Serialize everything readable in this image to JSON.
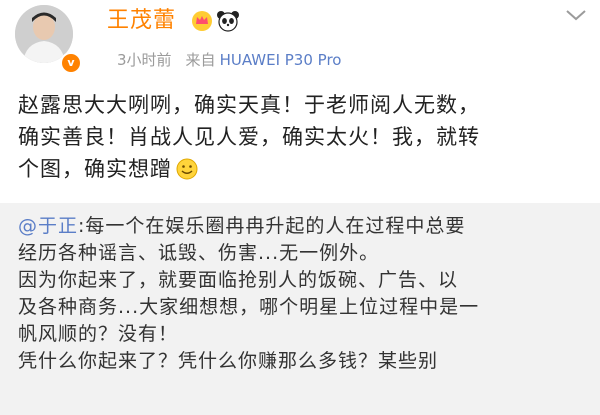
{
  "post": {
    "author": {
      "name": "王茂蕾",
      "verified_badge": "v",
      "badges": [
        "crown-icon",
        "panda-icon"
      ]
    },
    "meta": {
      "time": "3小时前",
      "source_prefix": "来自",
      "device": "HUAWEI P30 Pro"
    },
    "body_lines": [
      "赵露思大大咧咧，确实天真！于老师阅人无数，",
      "确实善良！肖战人见人爱，确实太火！我，就转",
      "个图，确实想蹭"
    ],
    "emoji": "smile-icon"
  },
  "quote": {
    "mention": "@于正",
    "lines": [
      ":每一个在娱乐圈冉冉升起的人在过程中总要",
      "经历各种谣言、诋毁、伤害...无一例外。",
      "因为你起来了，就要面临抢别人的饭碗、广告、以",
      "及各种商务...大家细想想，哪个明星上位过程中是一",
      "帆风顺的？没有！",
      "凭什么你起来了？凭什么你赚那么多钱？某些别"
    ],
    "watermark": "某些别"
  },
  "colors": {
    "accent": "#ff8200",
    "link": "#5b7ec7",
    "quote_bg": "#f2f2f2",
    "meta_gray": "#9b9b9b"
  }
}
